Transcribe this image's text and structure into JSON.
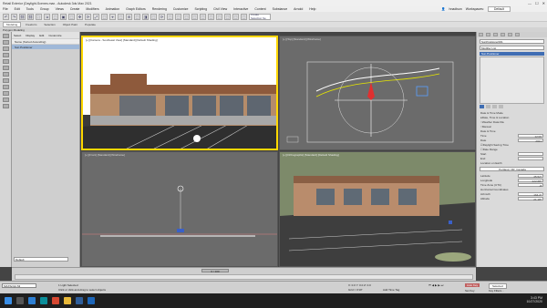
{
  "window": {
    "title": "Retail Exterior (Daylight-Scenes.max - Autodesk 3ds Max 2021",
    "minimize": "—",
    "maximize": "☐",
    "close": "✕"
  },
  "menubar": {
    "items": [
      "File",
      "Edit",
      "Tools",
      "Group",
      "Views",
      "Create",
      "Modifiers",
      "Animation",
      "Graph Editors",
      "Rendering",
      "Customize",
      "Scripting",
      "Civil View",
      "Interactive",
      "Content",
      "Substance",
      "Arnold",
      "Help"
    ],
    "user": "hnadison",
    "workspaces_label": "Workspaces:",
    "workspace": "Default"
  },
  "toolbar": {
    "icons": [
      "↶",
      "↷",
      "⛓",
      "⛓",
      "⛶",
      "⇲",
      "⬚",
      "▣",
      "⬚",
      "✥",
      "⟳",
      "⤢",
      "⬚",
      "⌖",
      "⬚",
      "⊕",
      "⬚",
      "◨",
      "⬚",
      "⟳",
      "⬚",
      "⬚",
      "⬚",
      "⬚",
      "⬚",
      "⬚",
      "⬚",
      "⬚",
      "⬚",
      "⬚"
    ],
    "selection_set": "Create Selection Se"
  },
  "ribbon": {
    "tabs": [
      "Modeling",
      "Freeform",
      "Selection",
      "Object Paint",
      "Populate"
    ],
    "active_tab": "Modeling",
    "sub_label": "Polygon Modeling"
  },
  "scene_explorer": {
    "tabs": [
      "Select",
      "Display",
      "Edit",
      "Customize"
    ],
    "header": "Name (Sorted Ascending)",
    "row": "Sun Positioner"
  },
  "viewports": {
    "top_left": "[+] [Camera - Southeast View] [Standard] [Default Shading]",
    "top_right": "[+] [Top] [Standard] [Wireframe]",
    "bottom_left": "[+] [Front] [Standard] [Wireframe]",
    "bottom_right": "[+] [Orthographic] [Standard] [Default Shading]"
  },
  "command_panel": {
    "object_name": "SunPositioner001",
    "modifier_list": "Modifier List",
    "stack_item": "Sun Positioner",
    "section_date_time": "Date & Time Mode",
    "mode_date_time": "Date, Time & Location",
    "mode_weather": "Weather Data File",
    "mode_manual": "Manual",
    "section_date": "Date & Time",
    "time_label": "Time",
    "time_value": "12:00",
    "date_label": "Date",
    "year_value": "2021",
    "daylight_saving": "Daylight Saving Time",
    "date_range": "Date Range",
    "start_label": "Start",
    "end_label": "End",
    "location_label": "Location on Earth",
    "location_value": "Portland, OR, Canada",
    "latitude_label": "Latitude",
    "latitude_value": "45.52°",
    "longitude_label": "Longitude",
    "longitude_value": "-122.68°",
    "timezone_label": "Time Zone (UTC)",
    "timezone_value": "-8",
    "horizontal_label": "Horizontal Coordinates",
    "azimuth_label": "Azimuth",
    "azimuth_value": "164.4°",
    "altitude_label": "Altitude",
    "altitude_value": "21.18°"
  },
  "timeline": {
    "frame": "0 / 100"
  },
  "status": {
    "maxscript": "MAXScript Mi",
    "selection_msg": "1 Light Selected",
    "hint_msg": "Click or click-and-drag to select objects",
    "coords": "X: 0.0   Y: 0.0   Z: 0.0",
    "grid": "Grid = 0'10\"",
    "add_time_tag": "Add Time Tag",
    "auto_key": "Auto Key",
    "selected": "Selected",
    "set_key": "Set Key",
    "key_filters": "Key Filters..."
  },
  "taskbar": {
    "time": "3:43 PM",
    "date": "10/27/2020"
  },
  "colors": {
    "active_border": "#ffd800",
    "selection_blue": "#3f6db3"
  }
}
